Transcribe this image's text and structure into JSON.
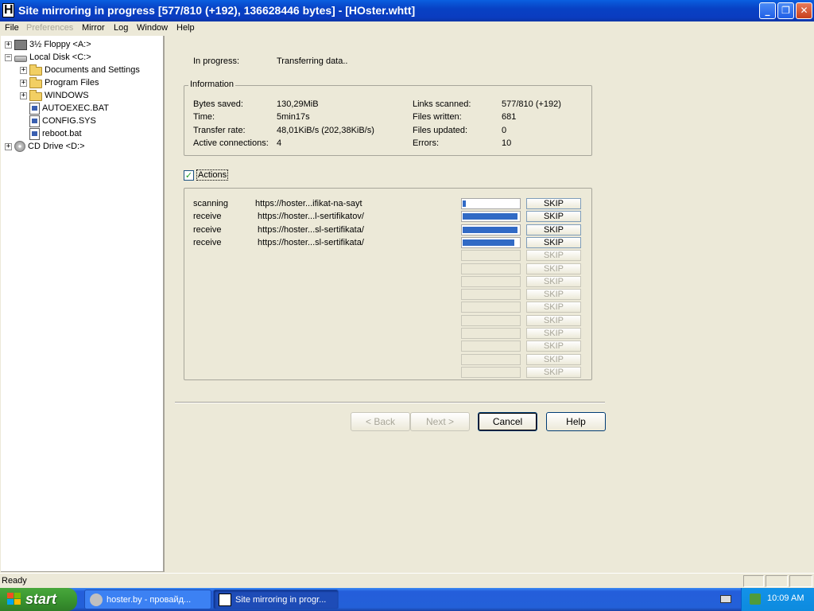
{
  "window": {
    "title": "Site mirroring in progress [577/810 (+192), 136628446 bytes] - [HOster.whtt]",
    "controls": [
      "_",
      "❐",
      "✕"
    ]
  },
  "menu": {
    "items": [
      "File",
      "Preferences",
      "Mirror",
      "Log",
      "Window",
      "Help"
    ]
  },
  "tree": {
    "items": [
      {
        "label": "3½ Floppy <A:>",
        "expander": "+"
      },
      {
        "label": "Local Disk <C:>",
        "expander": "−"
      },
      {
        "label": "Documents and Settings",
        "expander": "+"
      },
      {
        "label": "Program Files",
        "expander": "+"
      },
      {
        "label": "WINDOWS",
        "expander": "+"
      },
      {
        "label": "AUTOEXEC.BAT"
      },
      {
        "label": "CONFIG.SYS"
      },
      {
        "label": "reboot.bat"
      },
      {
        "label": "CD Drive <D:>",
        "expander": "+"
      }
    ]
  },
  "progress": {
    "label": "In progress:",
    "value": "Transferring data.."
  },
  "information": {
    "title": "Information",
    "left": [
      {
        "label": "Bytes saved:",
        "value": "130,29MiB"
      },
      {
        "label": "Time:",
        "value": "5min17s"
      },
      {
        "label": "Transfer rate:",
        "value": "48,01KiB/s (202,38KiB/s)"
      },
      {
        "label": "Active connections:",
        "value": "4"
      }
    ],
    "right": [
      {
        "label": "Links scanned:",
        "value": "577/810 (+192)"
      },
      {
        "label": "Files written:",
        "value": "681"
      },
      {
        "label": "Files updated:",
        "value": "0"
      },
      {
        "label": "Errors:",
        "value": "10"
      }
    ]
  },
  "actions": {
    "label": "Actions",
    "checked": "✓",
    "skip_label": "SKIP",
    "rows": [
      {
        "action": "scanning",
        "url": "https://hoster...ifikat-na-sayt",
        "progress": 0.06
      },
      {
        "action": "receive",
        "url": "https://hoster...l-sertifikatov/",
        "progress": 0.97
      },
      {
        "action": "receive",
        "url": "https://hoster...sl-sertifikata/",
        "progress": 0.97
      },
      {
        "action": "receive",
        "url": "https://hoster...sl-sertifikata/",
        "progress": 0.91
      }
    ],
    "empty_rows": 10
  },
  "buttons": {
    "back": "< Back",
    "next": "Next >",
    "cancel": "Cancel",
    "help": "Help"
  },
  "status": {
    "text": "Ready"
  },
  "taskbar": {
    "start": "start",
    "tasks": [
      {
        "label": "hoster.by - провайд..."
      },
      {
        "label": "Site mirroring in progr..."
      }
    ],
    "clock": "10:09 AM"
  },
  "colors": {
    "progress_fill": "#316ac5",
    "titlebar": "#0a3cc0",
    "taskbar": "#245edb",
    "start_button": "#3a9530"
  }
}
